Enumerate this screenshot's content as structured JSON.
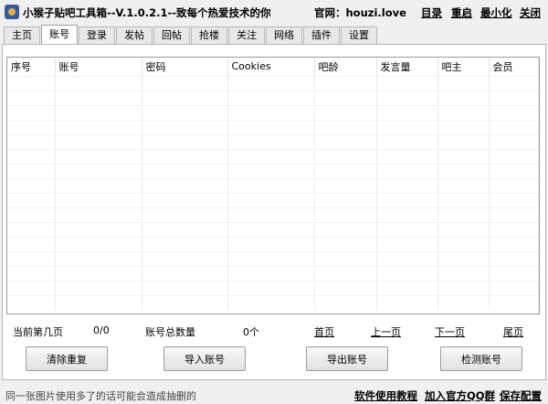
{
  "window": {
    "title": "小猴子贴吧工具箱--V.1.0.2.1--致每个热爱技术的你",
    "site": "官网：houzi.love",
    "menu": {
      "catalog": "目录",
      "restart": "重启",
      "minimize": "最小化",
      "close": "关闭"
    }
  },
  "tabs": [
    "主页",
    "账号",
    "登录",
    "发帖",
    "回帖",
    "抢楼",
    "关注",
    "网络",
    "插件",
    "设置"
  ],
  "active_tab": "账号",
  "table": {
    "columns": [
      "序号",
      "账号",
      "密码",
      "Cookies",
      "吧龄",
      "发言量",
      "吧主",
      "会员"
    ],
    "rows": []
  },
  "stats": {
    "current_page_label": "当前第几页",
    "current_page_value": "0/0",
    "total_label": "账号总数量",
    "total_value": "0个"
  },
  "pager": {
    "first": "首页",
    "prev": "上一页",
    "next": "下一页",
    "last": "尾页"
  },
  "buttons": {
    "clear_dup": "清除重复",
    "import": "导入账号",
    "export": "导出账号",
    "check": "检测账号"
  },
  "footer": {
    "tip": "同一张图片使用多了的话可能会造成抽删的",
    "tutorial": "软件使用教程",
    "qq_group": "加入官方QQ群",
    "save_config": "保存配置"
  }
}
